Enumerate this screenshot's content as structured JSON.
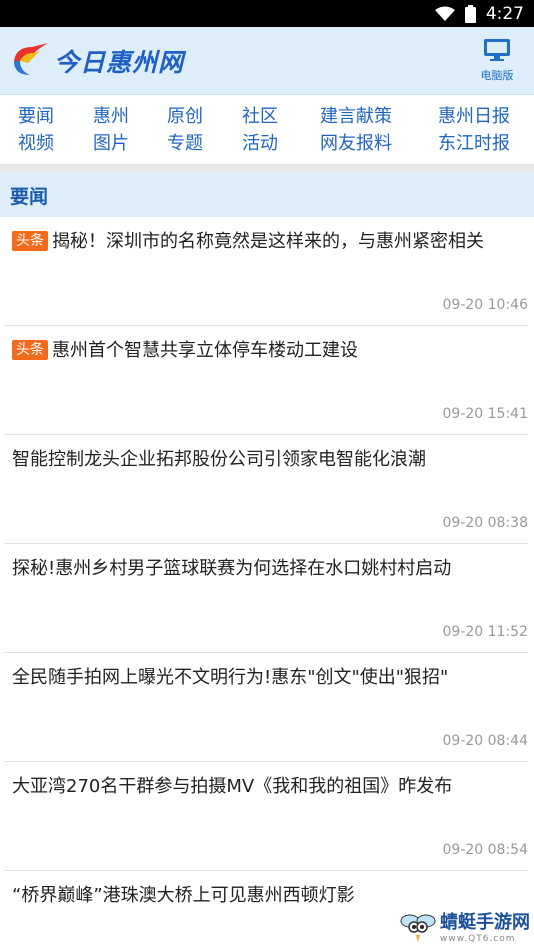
{
  "status_bar": {
    "time": "4:27"
  },
  "header": {
    "logo_text": "今日惠州网",
    "pc_label": "电脑版"
  },
  "nav": {
    "row1": [
      "要闻",
      "惠州",
      "原创",
      "社区",
      "建言献策",
      "惠州日报"
    ],
    "row2": [
      "视频",
      "图片",
      "专题",
      "活动",
      "网友报料",
      "东江时报"
    ]
  },
  "section": {
    "title": "要闻"
  },
  "news": [
    {
      "tag": "头条",
      "title": "揭秘！深圳市的名称竟然是这样来的，与惠州紧密相关",
      "time": "09-20 10:46"
    },
    {
      "tag": "头条",
      "title": "惠州首个智慧共享立体停车楼动工建设",
      "time": "09-20 15:41"
    },
    {
      "tag": "",
      "title": "智能控制龙头企业拓邦股份公司引领家电智能化浪潮",
      "time": "09-20 08:38"
    },
    {
      "tag": "",
      "title": "探秘!惠州乡村男子篮球联赛为何选择在水口姚村村启动",
      "time": "09-20 11:52"
    },
    {
      "tag": "",
      "title": "全民随手拍网上曝光不文明行为!惠东\"创文\"使出\"狠招\"",
      "time": "09-20 08:44"
    },
    {
      "tag": "",
      "title": "大亚湾270名干群参与拍摄MV《我和我的祖国》昨发布",
      "time": "09-20 08:54"
    },
    {
      "tag": "",
      "title": "“桥界巅峰”港珠澳大桥上可见惠州西顿灯影",
      "time": ""
    }
  ],
  "watermark": {
    "main": "蜻蜓手游网",
    "sub": "www.QT6.com"
  },
  "colors": {
    "accent": "#1f66c2",
    "header_bg": "#ddeefa",
    "tag": "#f26b1d"
  },
  "icons": [
    "wifi-icon",
    "battery-icon",
    "logo-bird-icon",
    "monitor-icon",
    "dragonfly-icon"
  ]
}
